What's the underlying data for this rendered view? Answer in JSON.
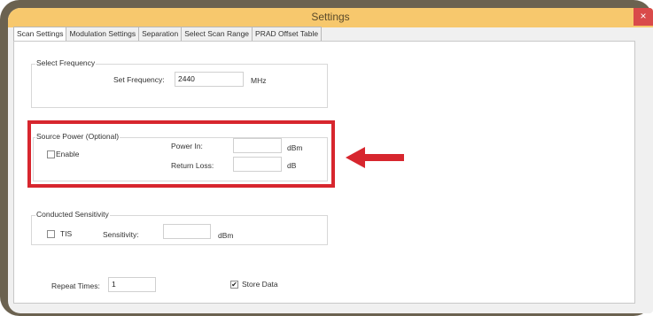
{
  "window": {
    "title": "Settings",
    "close_label": "×"
  },
  "tabs": [
    {
      "label": "Scan Settings",
      "active": true
    },
    {
      "label": "Modulation Settings",
      "active": false
    },
    {
      "label": "Separation",
      "active": false
    },
    {
      "label": "Select Scan Range",
      "active": false
    },
    {
      "label": "PRAD Offset Table",
      "active": false
    }
  ],
  "select_frequency": {
    "group_label": "Select Frequency",
    "set_label": "Set Frequency:",
    "value": "2440",
    "unit": "MHz"
  },
  "source_power": {
    "group_label": "Source Power (Optional)",
    "enable_label": "Enable",
    "enable_checked": false,
    "power_in_label": "Power In:",
    "power_in_value": "",
    "power_in_unit": "dBm",
    "return_loss_label": "Return Loss:",
    "return_loss_value": "",
    "return_loss_unit": "dB"
  },
  "conducted_sensitivity": {
    "group_label": "Conducted Sensitivity",
    "tis_label": "TIS",
    "tis_checked": false,
    "sensitivity_label": "Sensitivity:",
    "sensitivity_value": "",
    "sensitivity_unit": "dBm"
  },
  "bottom": {
    "repeat_label": "Repeat Times:",
    "repeat_value": "1",
    "store_label": "Store Data",
    "store_checked": true,
    "check_mark": "✔"
  },
  "colors": {
    "highlight": "#d7262e",
    "titlebar": "#f7c86d"
  }
}
